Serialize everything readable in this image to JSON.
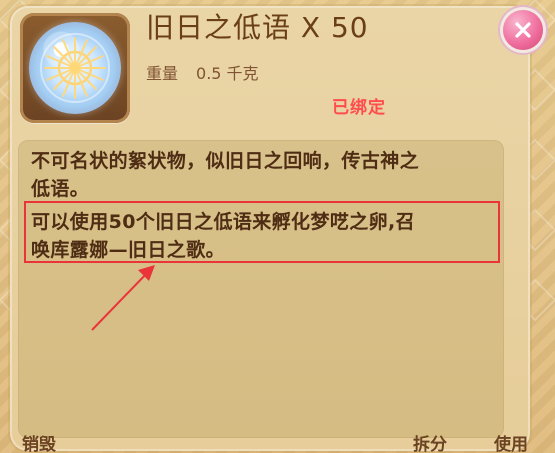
{
  "item": {
    "title": "旧日之低语 X 50",
    "weight_label": "重量",
    "weight_value": "0.5 千克",
    "bound_label": "已绑定",
    "icon": "crystal-orb-icon"
  },
  "description": {
    "line1": "不可名状的絮状物，似旧日之回响，传古神之",
    "line2": "低语。",
    "line3": "可以使用50个旧日之低语来孵化梦呓之卵,召",
    "line4": "唤库露娜—旧日之歌。"
  },
  "actions": {
    "destroy": "销毁",
    "split": "拆分",
    "use": "使用"
  },
  "ui": {
    "close_icon": "close-icon",
    "annotation_arrow_color": "#e9343a",
    "highlight_color": "#e9343a",
    "title_color": "#6a3e17",
    "bound_color": "#ff4d4d"
  }
}
